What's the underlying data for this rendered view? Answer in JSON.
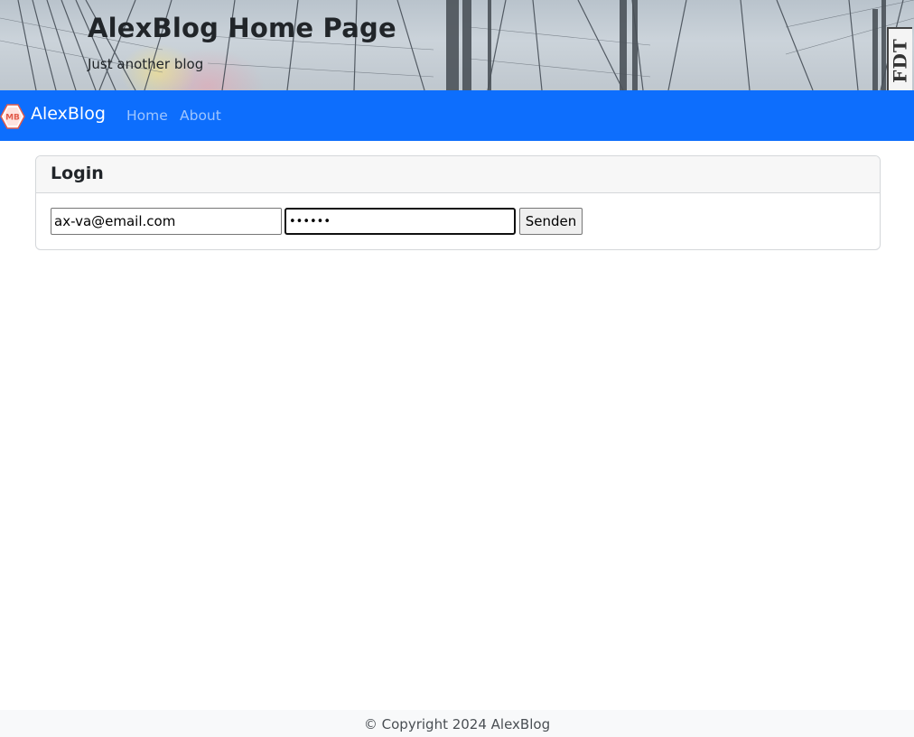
{
  "header": {
    "title": "AlexBlog Home Page",
    "tagline": "Just another blog"
  },
  "debug_toolbar": {
    "label": "FDT"
  },
  "navbar": {
    "logo_text": "MB",
    "brand": "AlexBlog",
    "links": [
      {
        "label": "Home"
      },
      {
        "label": "About"
      }
    ],
    "background_color": "#0d6efd"
  },
  "login": {
    "title": "Login",
    "email_value": "ax-va@email.com",
    "password_value": "••••••",
    "submit_label": "Senden"
  },
  "footer": {
    "text": "© Copyright 2024 AlexBlog"
  }
}
